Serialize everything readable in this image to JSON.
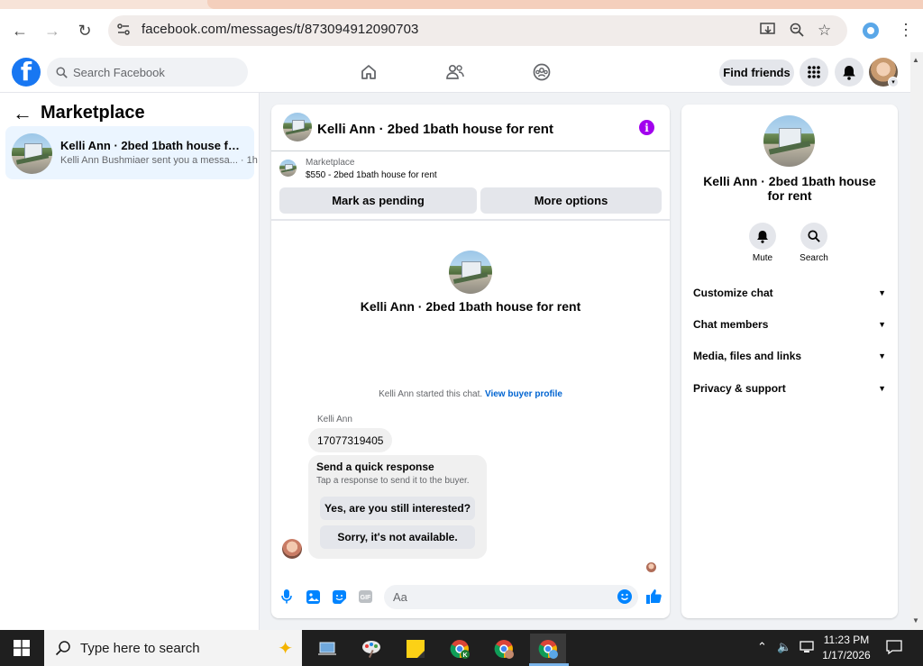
{
  "browser": {
    "url": "facebook.com/messages/t/873094912090703"
  },
  "header": {
    "search_placeholder": "Search Facebook",
    "find_friends": "Find friends"
  },
  "sidebar": {
    "title": "Marketplace",
    "thread": {
      "title": "Kelli Ann · 2bed 1bath house for re...",
      "preview": "Kelli Ann Bushmiaer sent you a messa... · 1h"
    }
  },
  "chat": {
    "header_title": "Kelli Ann · 2bed 1bath house for rent",
    "listing_label": "Marketplace",
    "listing_price": "$550 - 2bed 1bath house for rent",
    "mark_pending": "Mark as pending",
    "more_options": "More options",
    "intro_title": "Kelli Ann · 2bed 1bath house for rent",
    "started_text": "Kelli Ann started this chat.",
    "view_buyer": "View buyer profile",
    "sender_name": "Kelli Ann",
    "message": "17077319405",
    "quick_title": "Send a quick response",
    "quick_sub": "Tap a response to send it to the buyer.",
    "quick_option_1": "Yes, are you still interested?",
    "quick_option_2": "Sorry, it's not available.",
    "composer_placeholder": "Aa"
  },
  "details": {
    "title": "Kelli Ann · 2bed 1bath house for rent",
    "mute": "Mute",
    "search": "Search",
    "menu": [
      "Customize chat",
      "Chat members",
      "Media, files and links",
      "Privacy & support"
    ]
  },
  "taskbar": {
    "search_placeholder": "Type here to search",
    "time": "11:23 PM",
    "date": "1/17/2026"
  },
  "colors": {
    "fb_blue": "#1877f2",
    "messenger_blue": "#0084ff",
    "info_purple": "#a200ee",
    "selected_thread": "#ebf5ff"
  }
}
